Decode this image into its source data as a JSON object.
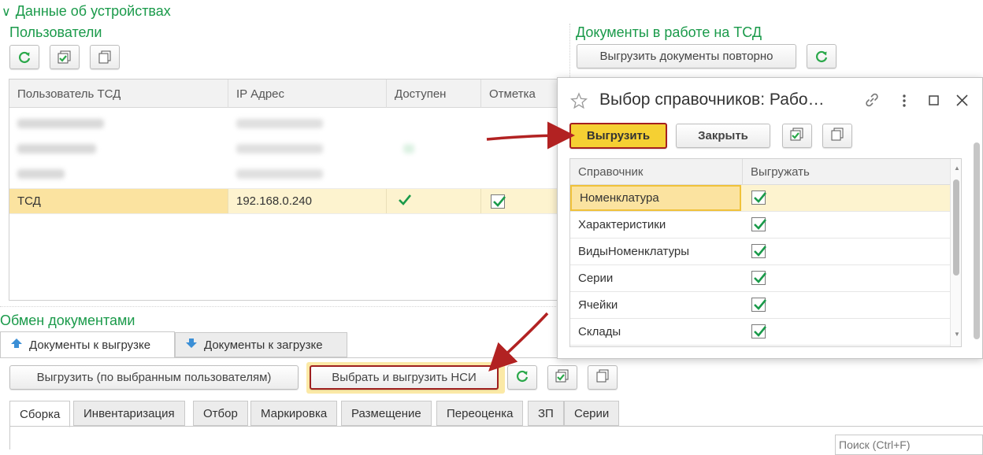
{
  "devices": {
    "toggle_glyph": "∨",
    "title": "Данные об устройствах"
  },
  "users": {
    "title": "Пользователи",
    "columns": [
      "Пользователь ТСД",
      "IP Адрес",
      "Доступен",
      "Отметка"
    ],
    "rows": [
      {
        "user": "ТСД",
        "ip": "192.168.0.240",
        "available": true,
        "mark": true
      }
    ]
  },
  "docs_on_device": {
    "title": "Документы в работе на ТСД",
    "reupload_label": "Выгрузить документы повторно"
  },
  "exchange": {
    "title": "Обмен документами",
    "tabs": [
      "Документы к выгрузке",
      "Документы к загрузке"
    ],
    "upload_selected_label": "Выгрузить (по выбранным пользователям)",
    "select_upload_nsi_label": "Выбрать и выгрузить НСИ",
    "subtabs": [
      "Сборка",
      "Инвентаризация",
      "Отбор",
      "Маркировка",
      "Размещение",
      "Переоценка",
      "ЗП",
      "Серии"
    ],
    "search_placeholder": "Поиск (Ctrl+F)"
  },
  "dialog": {
    "title": "Выбор справочников: Рабо…",
    "upload_label": "Выгрузить",
    "close_label": "Закрыть",
    "columns": [
      "Справочник",
      "Выгружать"
    ],
    "rows": [
      {
        "name": "Номенклатура",
        "checked": true
      },
      {
        "name": "Характеристики",
        "checked": true
      },
      {
        "name": "ВидыНоменклатуры",
        "checked": true
      },
      {
        "name": "Серии",
        "checked": true
      },
      {
        "name": "Ячейки",
        "checked": true
      },
      {
        "name": "Склады",
        "checked": true
      }
    ]
  },
  "colors": {
    "accent_green": "#1a9a4a",
    "selected_row": "#fbe9a6",
    "highlight_button": "#f5d033",
    "annotation_red": "#b22222"
  }
}
